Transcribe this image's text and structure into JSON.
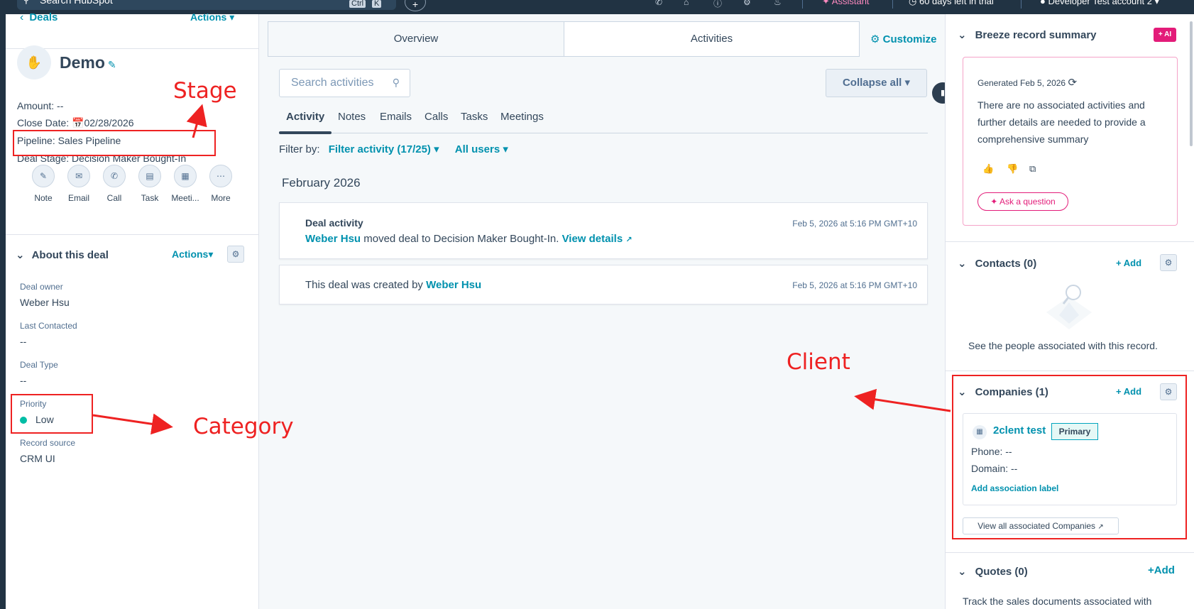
{
  "topbar": {
    "search_placeholder": "Search HubSpot",
    "kbd1": "Ctrl",
    "kbd2": "K",
    "plus": "+",
    "assistant": "Assistant",
    "trial": "60 days left in trial",
    "account": "Developer Test account 2"
  },
  "left": {
    "back_label": "Deals",
    "actions_label": "Actions",
    "record_name": "Demo",
    "amount": "Amount: --",
    "close_date_label": "Close Date:",
    "close_date": "02/28/2026",
    "pipeline": "Pipeline: Sales Pipeline",
    "deal_stage": "Deal Stage: Decision Maker Bought-In",
    "quick_actions": [
      "Note",
      "Email",
      "Call",
      "Task",
      "Meeti...",
      "More"
    ],
    "about_title": "About this deal",
    "about_actions": "Actions",
    "fields": [
      {
        "label": "Deal owner",
        "value": "Weber Hsu"
      },
      {
        "label": "Last Contacted",
        "value": "--"
      },
      {
        "label": "Deal Type",
        "value": "--"
      },
      {
        "label": "Priority",
        "value": "Low"
      },
      {
        "label": "Record source",
        "value": "CRM UI"
      }
    ]
  },
  "annotations": {
    "stage": "Stage",
    "category": "Category",
    "client": "Client"
  },
  "middle": {
    "tabs": [
      "Overview",
      "Activities"
    ],
    "customize": "Customize",
    "search_placeholder": "Search activities",
    "collapse_all": "Collapse all",
    "subtabs": [
      "Activity",
      "Notes",
      "Emails",
      "Calls",
      "Tasks",
      "Meetings"
    ],
    "filter_label": "Filter by:",
    "filter_activity": "Filter activity (17/25)",
    "all_users": "All users",
    "month": "February 2026",
    "activity1": {
      "title": "Deal activity",
      "actor": "Weber Hsu",
      "text": " moved deal to Decision Maker Bought-In. ",
      "link": "View details",
      "time": "Feb 5, 2026 at 5:16 PM GMT+10"
    },
    "activity2": {
      "text": "This deal was created by ",
      "actor": "Weber Hsu",
      "time": "Feb 5, 2026 at 5:16 PM GMT+10"
    }
  },
  "right": {
    "summary_title": "Breeze record summary",
    "ai_badge": "+ AI",
    "generated": "Generated Feb 5, 2026",
    "summary_text": "There are no associated activities and further details are needed to provide a comprehensive summary",
    "ask": "Ask a question",
    "contacts_title": "Contacts (0)",
    "add": "Add",
    "contacts_empty": "See the people associated with this record.",
    "companies_title": "Companies (1)",
    "company_name": "2clent test",
    "primary": "Primary",
    "phone": "Phone: --",
    "domain": "Domain: --",
    "add_assoc": "Add association label",
    "view_all": "View all associated Companies",
    "quotes_title": "Quotes (0)",
    "quotes_add": "+Add",
    "quotes_desc": "Track the sales documents associated with"
  },
  "colors": {
    "accent": "#0091ae",
    "annotation": "#ee2222",
    "ai_pink": "#e31c79",
    "nav": "#213343"
  }
}
